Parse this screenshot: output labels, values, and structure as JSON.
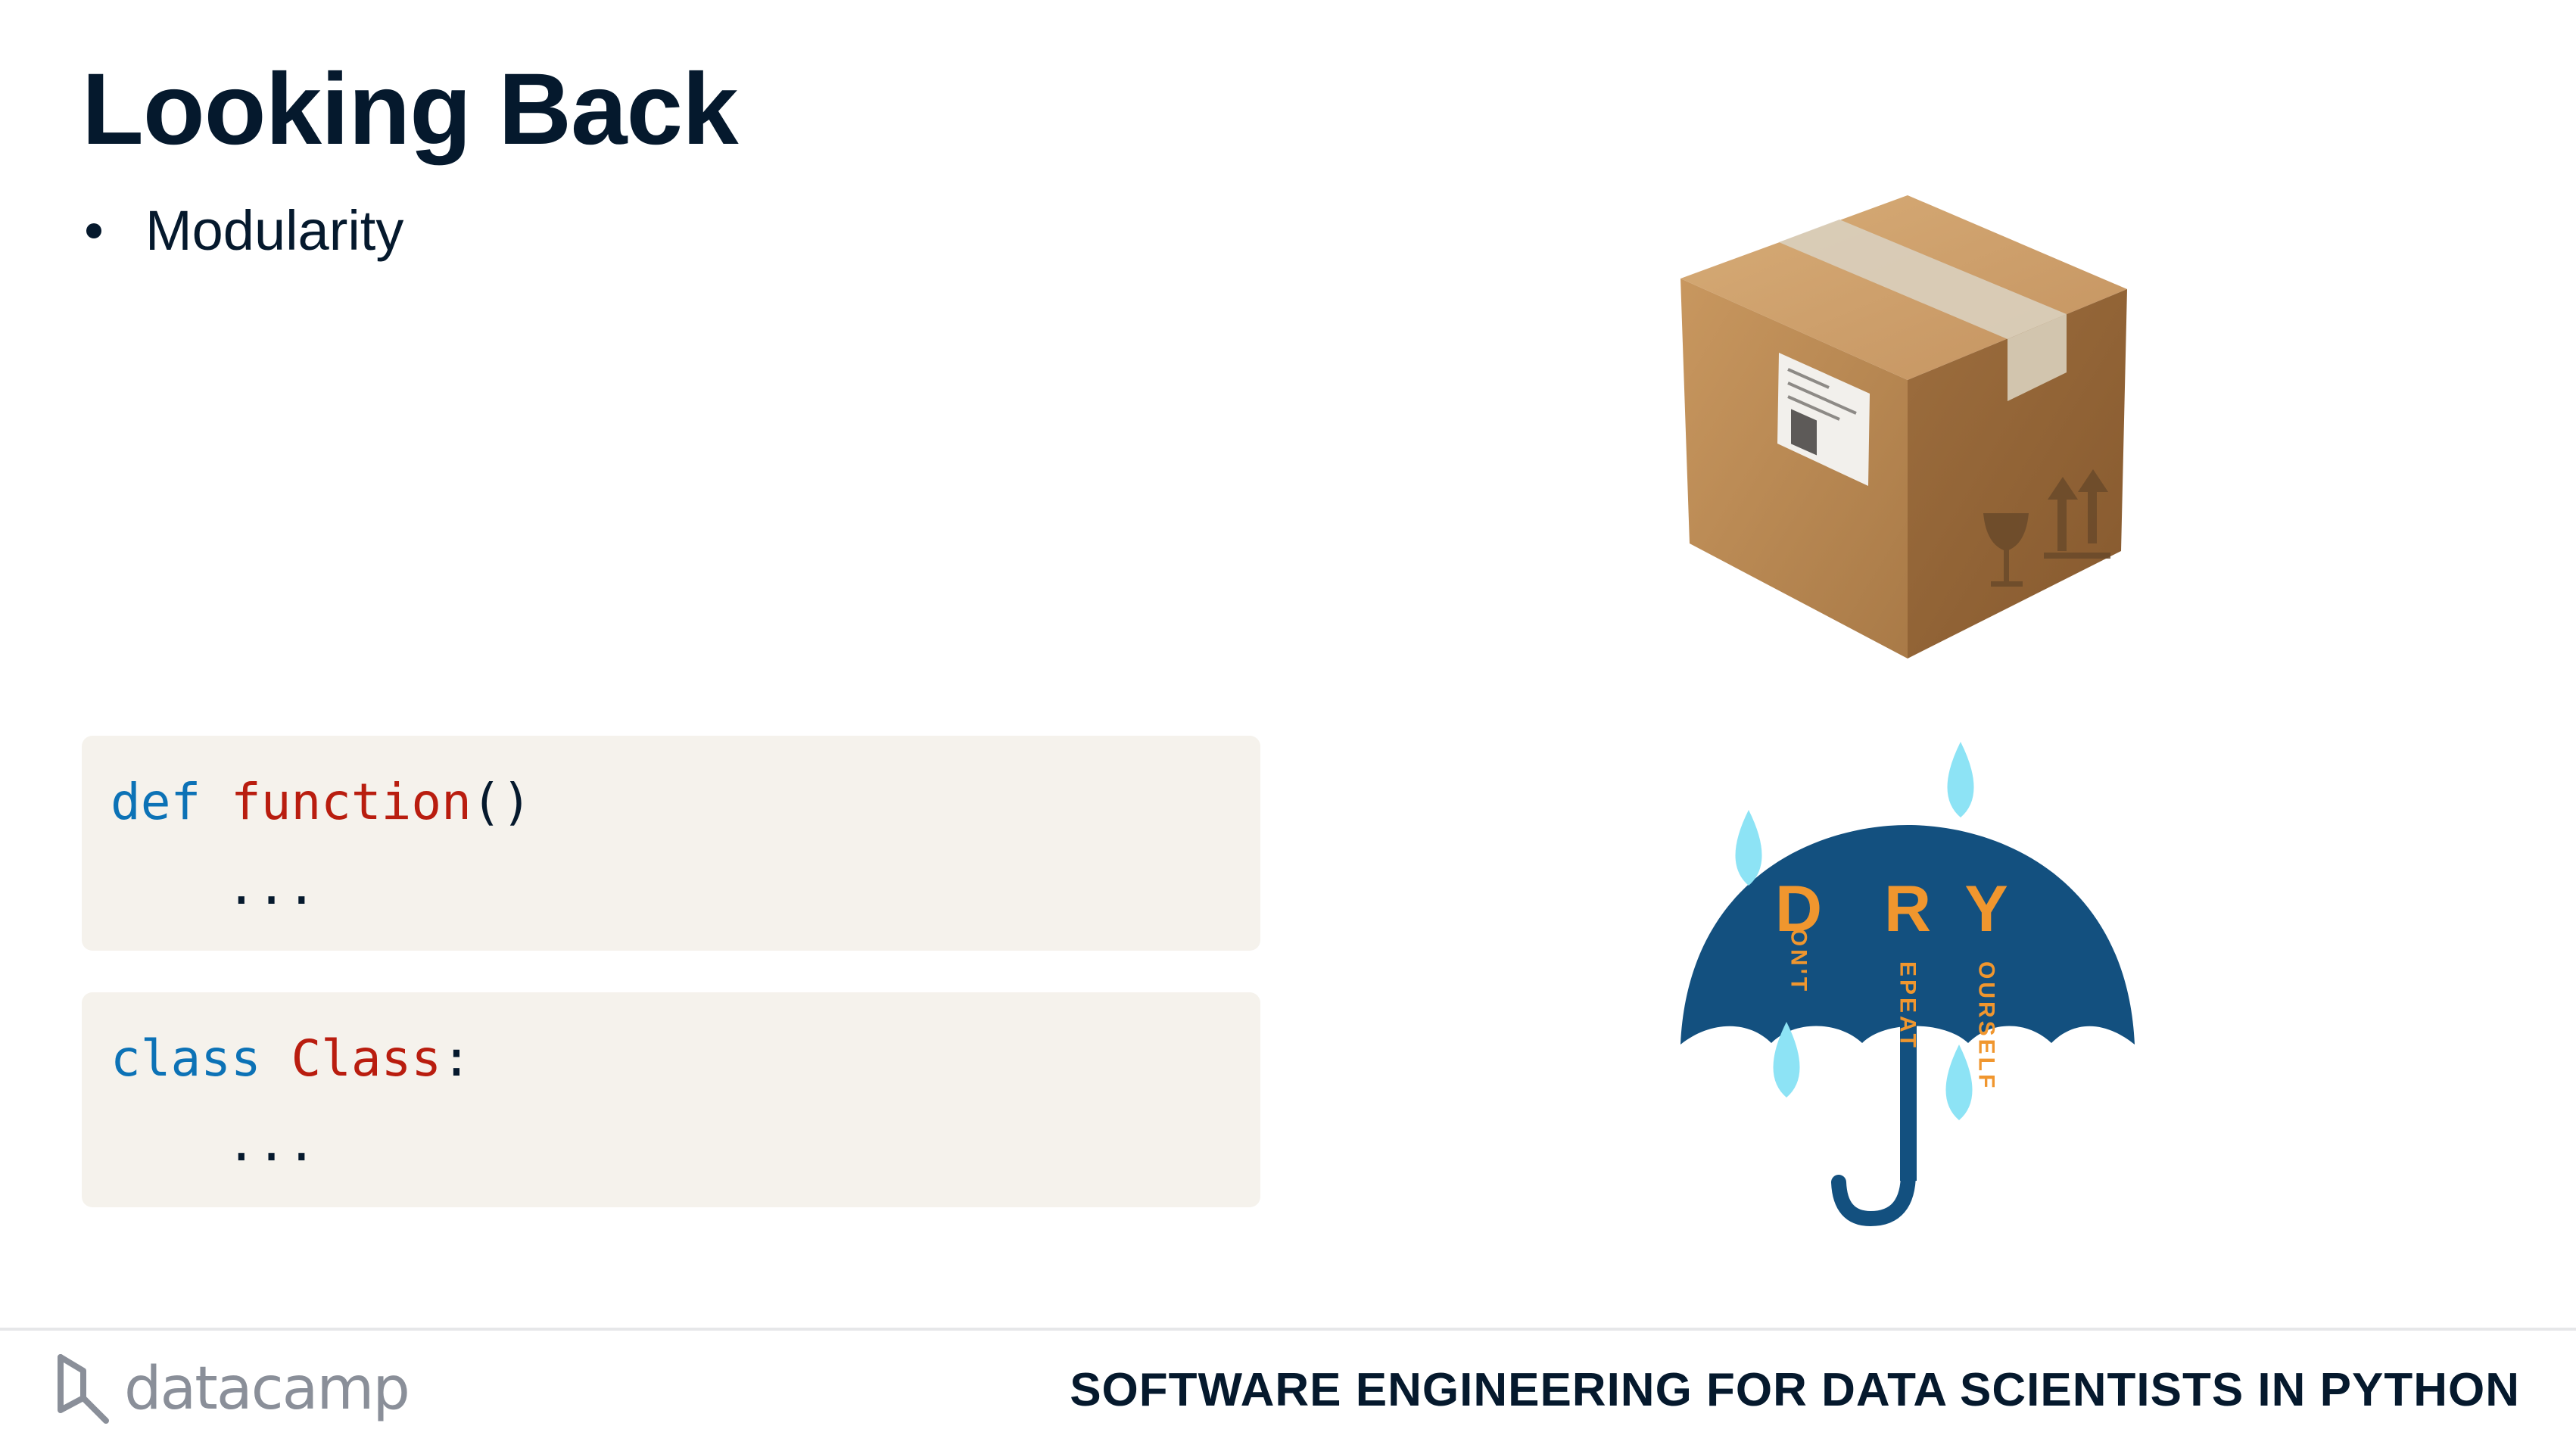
{
  "slide": {
    "title": "Looking Back",
    "bullets": [
      "Modularity"
    ]
  },
  "code_blocks": [
    {
      "keyword": "def",
      "name": "function",
      "suffix": "()",
      "body": "..."
    },
    {
      "keyword": "class",
      "name": "Class",
      "suffix": ":",
      "body": "..."
    }
  ],
  "illustrations": {
    "package": {
      "icon": "cardboard-box-icon",
      "colors": {
        "cardboard": "#b98a57",
        "tape": "#d8cbb6"
      }
    },
    "dry": {
      "icon": "umbrella-rain-icon",
      "letters": [
        "D",
        "R",
        "Y"
      ],
      "words": [
        "ON'T",
        "EPEAT",
        "OURSELF"
      ],
      "colors": {
        "umbrella": "#13507f",
        "letters": "#f0962e",
        "drops": "#8de3f5"
      }
    }
  },
  "footer": {
    "brand": "datacamp",
    "course": "SOFTWARE ENGINEERING FOR DATA SCIENTISTS IN PYTHON"
  }
}
